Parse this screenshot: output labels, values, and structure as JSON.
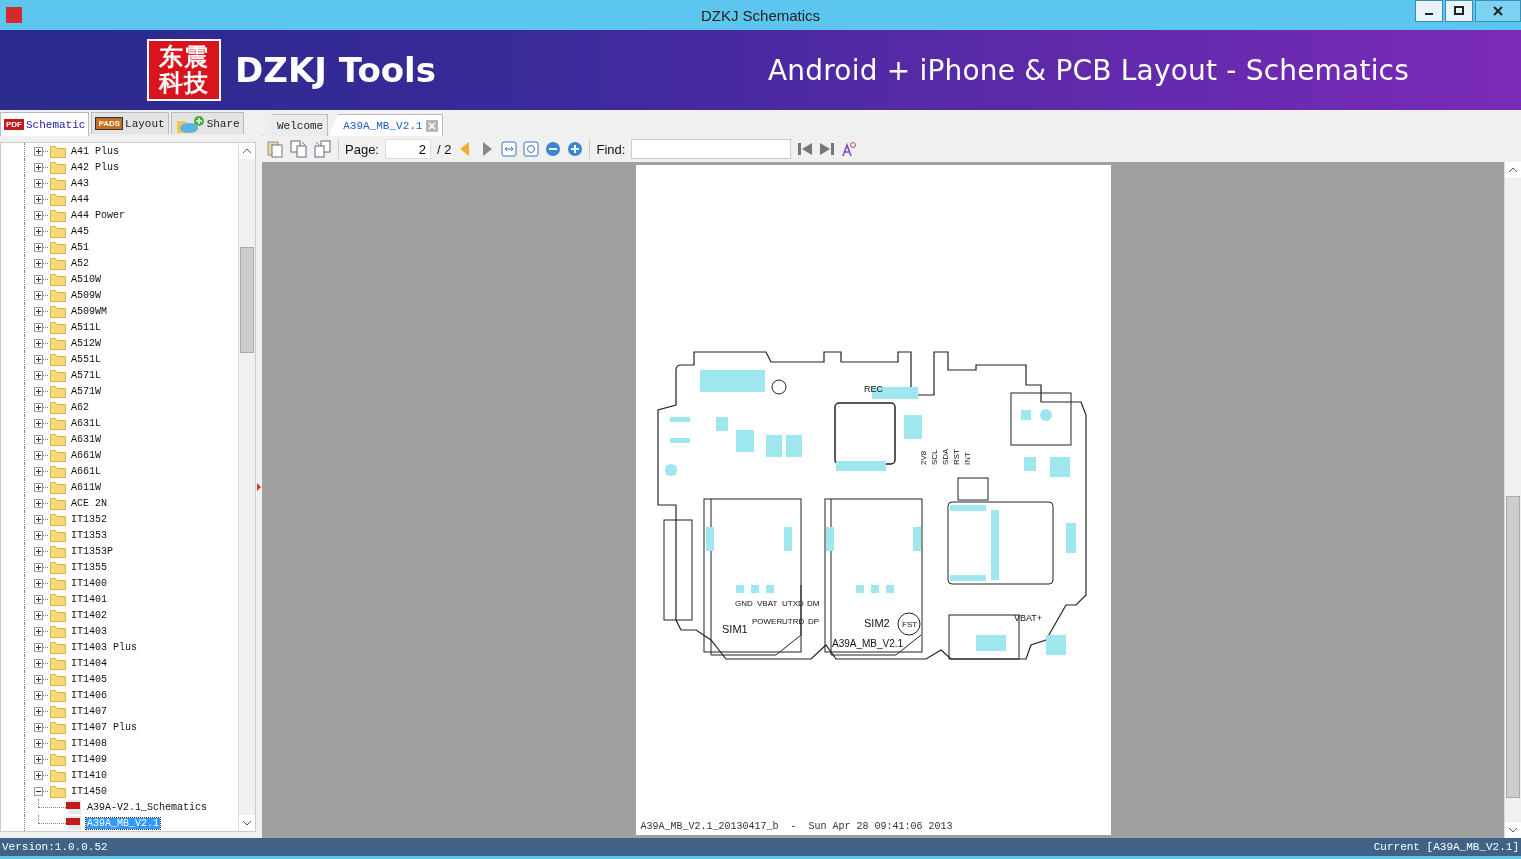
{
  "window": {
    "title": "DZKJ Schematics"
  },
  "banner": {
    "logo_lines": [
      "东震",
      "科技"
    ],
    "brand": "DZKJ Tools",
    "tagline": "Android + iPhone & PCB Layout - Schematics"
  },
  "side_tabs": [
    {
      "label": "Schematic",
      "kind": "pdf",
      "badge": "PDF",
      "selected": true
    },
    {
      "label": "Layout",
      "kind": "pads",
      "badge": "PADS",
      "selected": false
    },
    {
      "label": "Share",
      "kind": "cloud",
      "selected": false
    }
  ],
  "doc_tabs": [
    {
      "label": "Welcome",
      "selected": false,
      "closable": false
    },
    {
      "label": "A39A_MB_V2.1",
      "selected": true,
      "closable": true
    }
  ],
  "tree": [
    {
      "label": "A41 Plus",
      "expanded": false
    },
    {
      "label": "A42 Plus",
      "expanded": false
    },
    {
      "label": "A43",
      "expanded": false
    },
    {
      "label": "A44",
      "expanded": false
    },
    {
      "label": "A44 Power",
      "expanded": false
    },
    {
      "label": "A45",
      "expanded": false
    },
    {
      "label": "A51",
      "expanded": false
    },
    {
      "label": "A52",
      "expanded": false
    },
    {
      "label": "A510W",
      "expanded": false
    },
    {
      "label": "A509W",
      "expanded": false
    },
    {
      "label": "A509WM",
      "expanded": false
    },
    {
      "label": "A511L",
      "expanded": false
    },
    {
      "label": "A512W",
      "expanded": false
    },
    {
      "label": "A551L",
      "expanded": false
    },
    {
      "label": "A571L",
      "expanded": false
    },
    {
      "label": "A571W",
      "expanded": false
    },
    {
      "label": "A62",
      "expanded": false
    },
    {
      "label": "A631L",
      "expanded": false
    },
    {
      "label": "A631W",
      "expanded": false
    },
    {
      "label": "A661W",
      "expanded": false
    },
    {
      "label": "A661L",
      "expanded": false
    },
    {
      "label": "A611W",
      "expanded": false
    },
    {
      "label": "ACE 2N",
      "expanded": false
    },
    {
      "label": "IT1352",
      "expanded": false
    },
    {
      "label": "IT1353",
      "expanded": false
    },
    {
      "label": "IT1353P",
      "expanded": false
    },
    {
      "label": "IT1355",
      "expanded": false
    },
    {
      "label": "IT1400",
      "expanded": false
    },
    {
      "label": "IT1401",
      "expanded": false
    },
    {
      "label": "IT1402",
      "expanded": false
    },
    {
      "label": "IT1403",
      "expanded": false
    },
    {
      "label": "IT1403 Plus",
      "expanded": false
    },
    {
      "label": "IT1404",
      "expanded": false
    },
    {
      "label": "IT1405",
      "expanded": false
    },
    {
      "label": "IT1406",
      "expanded": false
    },
    {
      "label": "IT1407",
      "expanded": false
    },
    {
      "label": "IT1407 Plus",
      "expanded": false
    },
    {
      "label": "IT1408",
      "expanded": false
    },
    {
      "label": "IT1409",
      "expanded": false
    },
    {
      "label": "IT1410",
      "expanded": false
    },
    {
      "label": "IT1450",
      "expanded": true,
      "children": [
        {
          "label": "A39A-V2.1_Schematics",
          "selected": false
        },
        {
          "label": "A39A_MB_V2.1",
          "selected": true
        }
      ]
    }
  ],
  "toolbar": {
    "page_label": "Page:",
    "page_value": "2",
    "page_total": "/ 2",
    "find_label": "Find:"
  },
  "document": {
    "board_labels": [
      "REC",
      "2V8",
      "SCL",
      "SDA",
      "RST",
      "INT",
      "GND",
      "VBAT",
      "UTXD",
      "DM",
      "POWER",
      "UTRD",
      "DP",
      "SIM1",
      "SIM2",
      "FST",
      "A39A_MB_V2.1",
      "VBAT+"
    ],
    "footer": "A39A_MB_V2.1_20130417_b  -  Sun Apr 28 09:41:06 2013"
  },
  "status_bar": {
    "version": "Version:1.0.0.52",
    "current": "Current [A39A_MB_V2.1]"
  }
}
